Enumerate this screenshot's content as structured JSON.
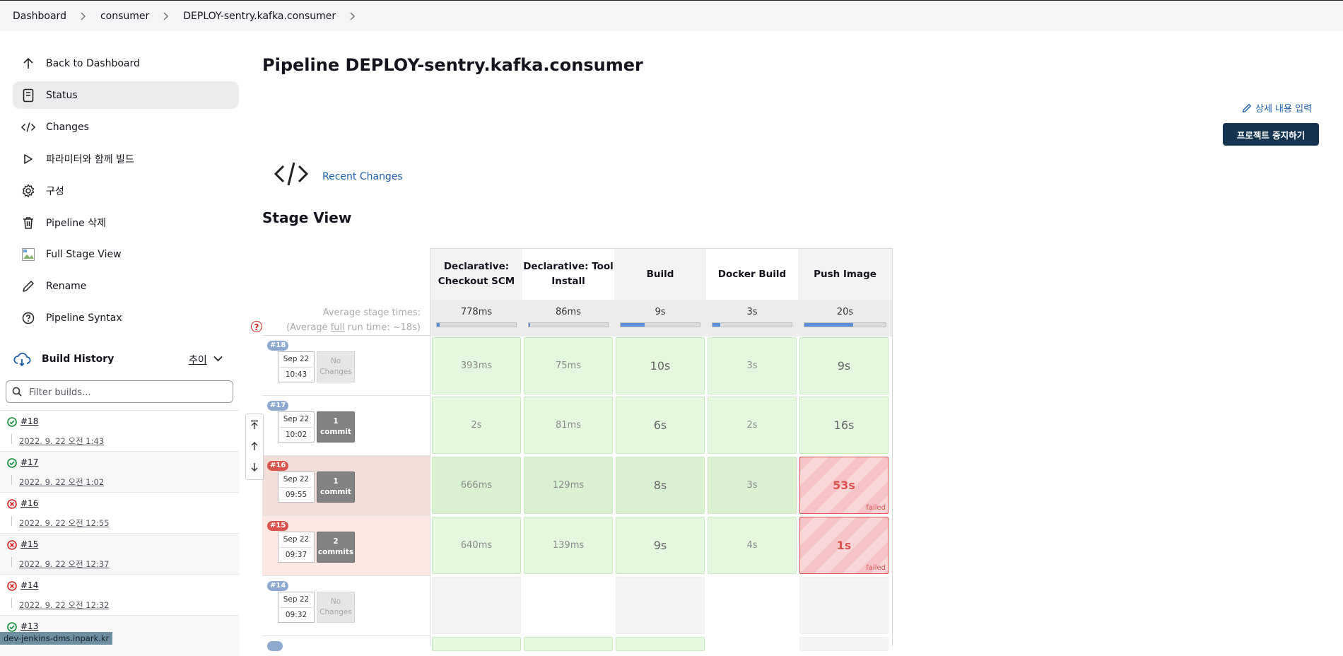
{
  "breadcrumb": [
    "Dashboard",
    "consumer",
    "DEPLOY-sentry.kafka.consumer"
  ],
  "sidebar": {
    "items": [
      {
        "label": "Back to Dashboard",
        "icon": "arrow-up-icon"
      },
      {
        "label": "Status",
        "icon": "document-icon",
        "active": true
      },
      {
        "label": "Changes",
        "icon": "code-icon"
      },
      {
        "label": "파라미터와 함께 빌드",
        "icon": "play-icon"
      },
      {
        "label": "구성",
        "icon": "gear-icon"
      },
      {
        "label": "Pipeline 삭제",
        "icon": "trash-icon"
      },
      {
        "label": "Full Stage View",
        "icon": "broken-image-icon"
      },
      {
        "label": "Rename",
        "icon": "pencil-icon"
      },
      {
        "label": "Pipeline Syntax",
        "icon": "help-circle-icon"
      }
    ]
  },
  "build_history": {
    "title": "Build History",
    "trend_label": "추이",
    "filter_placeholder": "Filter builds...",
    "builds": [
      {
        "number": "#18",
        "date": "2022. 9. 22 오전 1:43",
        "status": "success"
      },
      {
        "number": "#17",
        "date": "2022. 9. 22 오전 1:02",
        "status": "success"
      },
      {
        "number": "#16",
        "date": "2022. 9. 22 오전 12:55",
        "status": "failed"
      },
      {
        "number": "#15",
        "date": "2022. 9. 22 오전 12:37",
        "status": "failed"
      },
      {
        "number": "#14",
        "date": "2022. 9. 22 오전 12:32",
        "status": "failed"
      },
      {
        "number": "#13",
        "date": "",
        "status": "success"
      }
    ]
  },
  "status_url": "dev-jenkins-dms.inpark.kr",
  "main": {
    "title": "Pipeline DEPLOY-sentry.kafka.consumer",
    "edit_description": "상세 내용 입력",
    "disable_button": "프로젝트 중지하기",
    "recent_changes": "Recent Changes",
    "stage_view_title": "Stage View"
  },
  "stage_view": {
    "avg_label_1": "Average stage times:",
    "avg_label_2a": "(Average ",
    "avg_label_full": "full",
    "avg_label_2b": " run time: ~18s)",
    "help": "?",
    "stages": [
      {
        "name": "Declarative: Checkout SCM",
        "avg": "778ms",
        "avg_fraction": 0.04
      },
      {
        "name": "Declarative: Tool Install",
        "avg": "86ms",
        "avg_fraction": 0.01
      },
      {
        "name": "Build",
        "avg": "9s",
        "avg_fraction": 0.3
      },
      {
        "name": "Docker Build",
        "avg": "3s",
        "avg_fraction": 0.1
      },
      {
        "name": "Push Image",
        "avg": "20s",
        "avg_fraction": 0.6
      }
    ],
    "runs": [
      {
        "badge": "#18",
        "date": "Sep 22",
        "time": "10:43",
        "changes": "No Changes",
        "has_changes": false,
        "state": "success",
        "cells": [
          {
            "v": "393ms",
            "s": "ok"
          },
          {
            "v": "75ms",
            "s": "ok"
          },
          {
            "v": "10s",
            "s": "ok"
          },
          {
            "v": "3s",
            "s": "ok"
          },
          {
            "v": "9s",
            "s": "ok"
          }
        ]
      },
      {
        "badge": "#17",
        "date": "Sep 22",
        "time": "10:02",
        "changes": "1 commit",
        "has_changes": true,
        "state": "success",
        "cells": [
          {
            "v": "2s",
            "s": "ok"
          },
          {
            "v": "81ms",
            "s": "ok"
          },
          {
            "v": "6s",
            "s": "ok"
          },
          {
            "v": "2s",
            "s": "ok"
          },
          {
            "v": "16s",
            "s": "ok"
          }
        ]
      },
      {
        "badge": "#16",
        "date": "Sep 22",
        "time": "09:55",
        "changes": "1 commit",
        "has_changes": true,
        "state": "failed",
        "cells": [
          {
            "v": "666ms",
            "s": "ok"
          },
          {
            "v": "129ms",
            "s": "ok"
          },
          {
            "v": "8s",
            "s": "ok"
          },
          {
            "v": "3s",
            "s": "ok"
          },
          {
            "v": "53s",
            "s": "failed",
            "note": "failed"
          }
        ]
      },
      {
        "badge": "#15",
        "date": "Sep 22",
        "time": "09:37",
        "changes": "2 commits",
        "has_changes": true,
        "state": "failed",
        "cells": [
          {
            "v": "640ms",
            "s": "ok"
          },
          {
            "v": "139ms",
            "s": "ok"
          },
          {
            "v": "9s",
            "s": "ok"
          },
          {
            "v": "4s",
            "s": "ok"
          },
          {
            "v": "1s",
            "s": "failed",
            "note": "failed"
          }
        ]
      },
      {
        "badge": "#14",
        "date": "Sep 22",
        "time": "09:32",
        "changes": "No Changes",
        "has_changes": false,
        "state": "failed",
        "cells": [
          {
            "v": "",
            "s": "empty"
          },
          {
            "v": "",
            "s": "blank"
          },
          {
            "v": "",
            "s": "empty"
          },
          {
            "v": "",
            "s": "blank"
          },
          {
            "v": "",
            "s": "empty"
          }
        ]
      }
    ]
  },
  "colors": {
    "link": "#1c5ea8",
    "failed": "#d9534f",
    "success": "#138a36",
    "button": "#14334f"
  }
}
